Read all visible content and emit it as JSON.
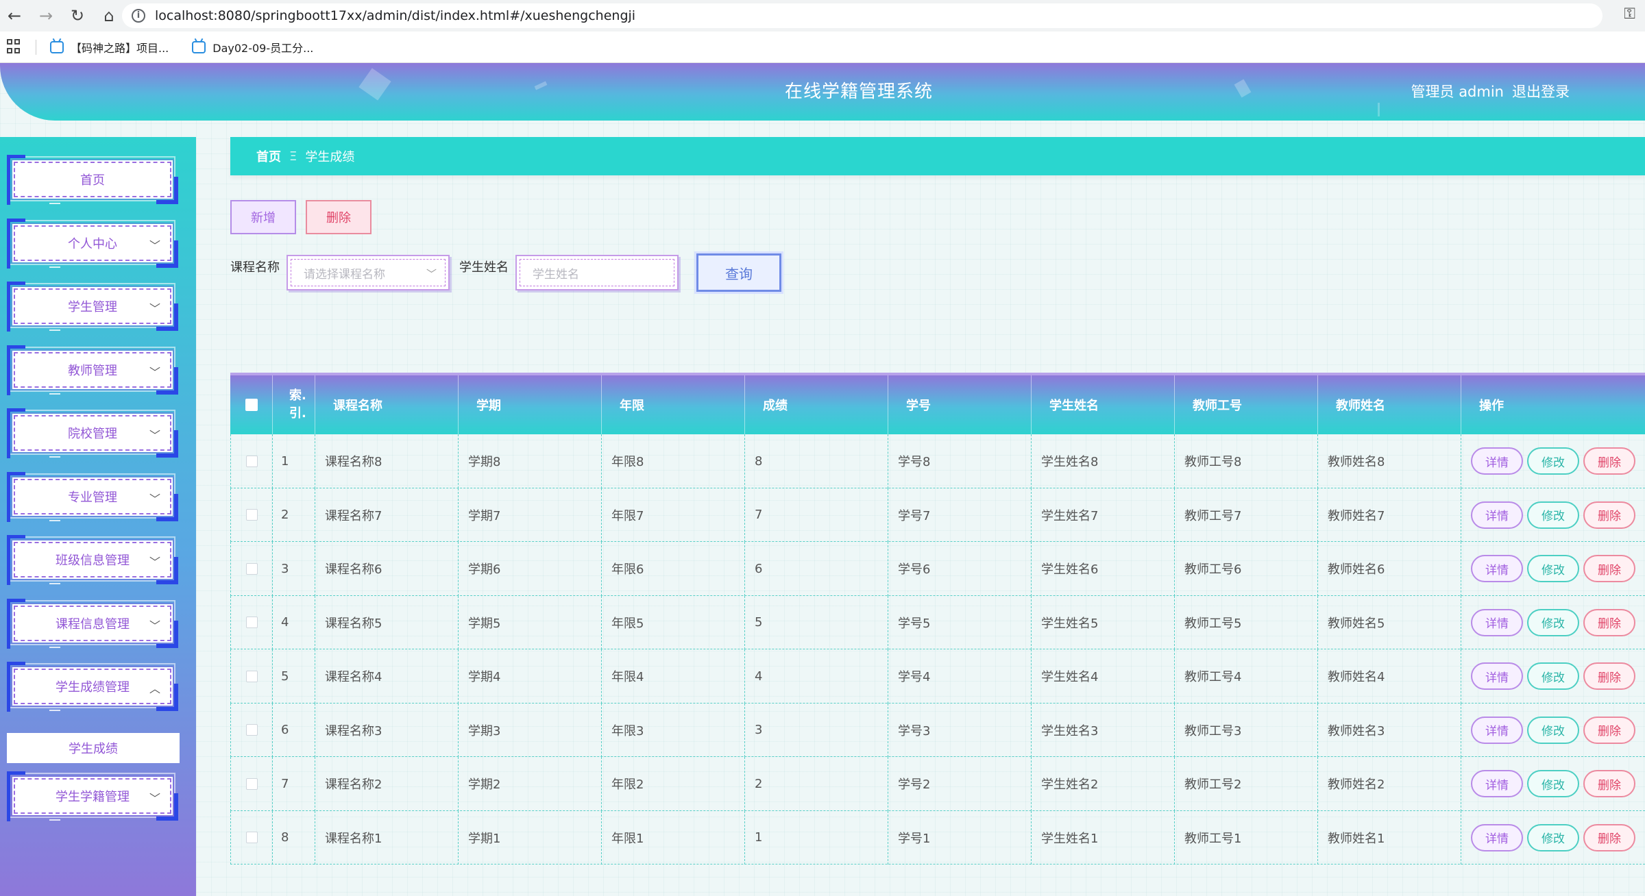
{
  "browser": {
    "url": "localhost:8080/springboott17xx/admin/dist/index.html#/xueshengchengji",
    "bookmarks": [
      "【码神之路】项目...",
      "Day02-09-员工分..."
    ]
  },
  "header": {
    "title": "在线学籍管理系统",
    "user_label": "管理员 admin",
    "logout_label": "退出登录"
  },
  "sidebar": {
    "items": [
      {
        "label": "首页",
        "has_arrow": false
      },
      {
        "label": "个人中心",
        "has_arrow": true
      },
      {
        "label": "学生管理",
        "has_arrow": true
      },
      {
        "label": "教师管理",
        "has_arrow": true
      },
      {
        "label": "院校管理",
        "has_arrow": true
      },
      {
        "label": "专业管理",
        "has_arrow": true
      },
      {
        "label": "班级信息管理",
        "has_arrow": true
      },
      {
        "label": "课程信息管理",
        "has_arrow": true
      },
      {
        "label": "学生成绩管理",
        "has_arrow": true,
        "expanded": true
      },
      {
        "label": "学生学籍管理",
        "has_arrow": true
      }
    ],
    "submenu_item": "学生成绩"
  },
  "breadcrumb": {
    "home": "首页",
    "separator": "Ξ",
    "current": "学生成绩"
  },
  "toolbar": {
    "add_label": "新增",
    "delete_label": "删除"
  },
  "search": {
    "course_label": "课程名称",
    "course_placeholder": "请选择课程名称",
    "student_label": "学生姓名",
    "student_placeholder": "学生姓名",
    "query_label": "查询"
  },
  "table": {
    "headers": [
      "索引",
      "课程名称",
      "学期",
      "年限",
      "成绩",
      "学号",
      "学生姓名",
      "教师工号",
      "教师姓名",
      "操作"
    ],
    "index_header_display": "索.\n引.",
    "rows": [
      [
        "1",
        "课程名称8",
        "学期8",
        "年限8",
        "8",
        "学号8",
        "学生姓名8",
        "教师工号8",
        "教师姓名8"
      ],
      [
        "2",
        "课程名称7",
        "学期7",
        "年限7",
        "7",
        "学号7",
        "学生姓名7",
        "教师工号7",
        "教师姓名7"
      ],
      [
        "3",
        "课程名称6",
        "学期6",
        "年限6",
        "6",
        "学号6",
        "学生姓名6",
        "教师工号6",
        "教师姓名6"
      ],
      [
        "4",
        "课程名称5",
        "学期5",
        "年限5",
        "5",
        "学号5",
        "学生姓名5",
        "教师工号5",
        "教师姓名5"
      ],
      [
        "5",
        "课程名称4",
        "学期4",
        "年限4",
        "4",
        "学号4",
        "学生姓名4",
        "教师工号4",
        "教师姓名4"
      ],
      [
        "6",
        "课程名称3",
        "学期3",
        "年限3",
        "3",
        "学号3",
        "学生姓名3",
        "教师工号3",
        "教师姓名3"
      ],
      [
        "7",
        "课程名称2",
        "学期2",
        "年限2",
        "2",
        "学号2",
        "学生姓名2",
        "教师工号2",
        "教师姓名2"
      ],
      [
        "8",
        "课程名称1",
        "学期1",
        "年限1",
        "1",
        "学号1",
        "学生姓名1",
        "教师工号1",
        "教师姓名1"
      ]
    ],
    "actions": {
      "detail": "详情",
      "edit": "修改",
      "delete": "删除"
    }
  },
  "colors": {
    "accent_teal": "#2ad6cf",
    "accent_purple": "#8e78da",
    "text_purple": "#9257d6",
    "danger": "#e04468"
  }
}
